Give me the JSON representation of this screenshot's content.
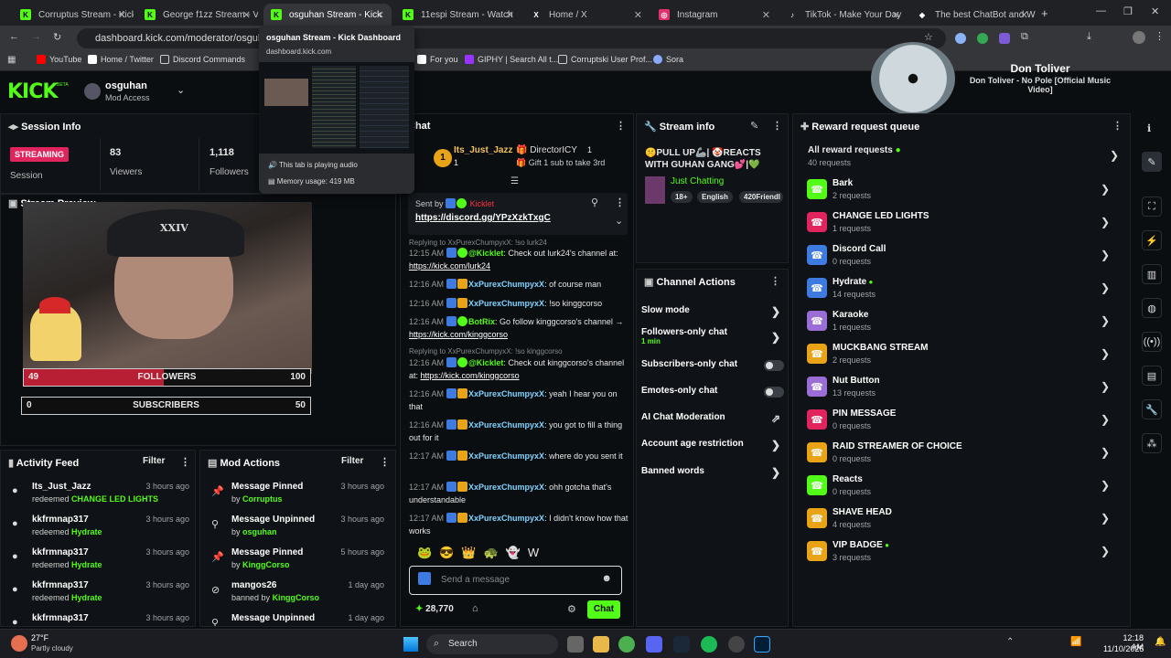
{
  "tabs": [
    {
      "title": "Corruptus Stream - Kick D",
      "fav": "K",
      "color": "#53fc18"
    },
    {
      "title": "George f1zz Stream - V",
      "fav": "K",
      "color": "#53fc18"
    },
    {
      "title": "osguhan Stream - Kick",
      "fav": "K",
      "color": "#53fc18"
    },
    {
      "title": "11espi Stream - Watch",
      "fav": "K",
      "color": "#53fc18"
    },
    {
      "title": "Home / X",
      "fav": "X",
      "color": "#ffffff"
    },
    {
      "title": "Instagram",
      "fav": "◎",
      "color": "#e1306c"
    },
    {
      "title": "TikTok - Make Your Day",
      "fav": "♪",
      "color": "#ffffff"
    },
    {
      "title": "The best ChatBot and Wi",
      "fav": "◆",
      "color": "#ffffff"
    }
  ],
  "tooltip": {
    "title": "osguhan Stream - Kick Dashboard",
    "domain": "dashboard.kick.com",
    "audio": "This tab is playing audio",
    "memory": "Memory usage: 419 MB"
  },
  "address": {
    "url": "dashboard.kick.com/moderator/osguhan"
  },
  "bookmarks": [
    "YouTube",
    "Home / Twitter",
    "Discord Commands",
    "For you",
    "GIPHY | Search All t...",
    "Corruptski User Prof...",
    "Sora"
  ],
  "header": {
    "logo": "KICK",
    "beta": "BETA",
    "user": "osguhan",
    "role": "Mod Access"
  },
  "now_playing": {
    "artist": "Don Toliver",
    "track": "Don Toliver - No Pole [Official Music Video]"
  },
  "session": {
    "title": "Session Info",
    "status": "STREAMING",
    "session_label": "Session",
    "viewers": "83",
    "viewers_label": "Viewers",
    "followers": "1,118",
    "followers_label": "Followers"
  },
  "preview": {
    "title": "Stream Preview",
    "followers_goal": {
      "current": "49",
      "label": "FOLLOWERS",
      "target": "100",
      "fraction": 0.49
    },
    "subs_goal": {
      "current": "0",
      "label": "SUBSCRIBERS",
      "target": "50",
      "fraction": 0
    }
  },
  "activity": {
    "title": "Activity Feed",
    "filter": "Filter",
    "items": [
      {
        "name": "Its_Just_Jazz",
        "prefix": "redeemed",
        "reward": "CHANGE LED LIGHTS",
        "time": "3 hours ago"
      },
      {
        "name": "kkfrmnap317",
        "prefix": "redeemed",
        "reward": "Hydrate",
        "time": "3 hours ago"
      },
      {
        "name": "kkfrmnap317",
        "prefix": "redeemed",
        "reward": "Hydrate",
        "time": "3 hours ago"
      },
      {
        "name": "kkfrmnap317",
        "prefix": "redeemed",
        "reward": "Hydrate",
        "time": "3 hours ago"
      },
      {
        "name": "kkfrmnap317",
        "prefix": "",
        "reward": "",
        "time": "3 hours ago"
      }
    ]
  },
  "modactions": {
    "title": "Mod Actions",
    "filter": "Filter",
    "items": [
      {
        "action": "Message Pinned",
        "by": "by",
        "user": "Corruptus",
        "time": "3 hours ago",
        "icon": "pin"
      },
      {
        "action": "Message Unpinned",
        "by": "by",
        "user": "osguhan",
        "time": "3 hours ago",
        "icon": "unpin"
      },
      {
        "action": "Message Pinned",
        "by": "by",
        "user": "KinggCorso",
        "time": "5 hours ago",
        "icon": "pin"
      },
      {
        "action": "mangos26",
        "by": "banned by",
        "user": "KinggCorso",
        "time": "1 day ago",
        "icon": "ban"
      },
      {
        "action": "Message Unpinned",
        "by": "",
        "user": "",
        "time": "1 day ago",
        "icon": "unpin"
      }
    ]
  },
  "chat": {
    "title": "Chat",
    "top_gifter": {
      "rank": "1",
      "name": "Its_Just_Jazz",
      "count": "1",
      "other": "DirectorICY",
      "other_count": "1",
      "gift_note": "Gift 1 sub to take 3rd"
    },
    "pinned": {
      "sent_by": "Sent by",
      "sender": "Kicklet",
      "link": "https://discord.gg/YPzXzkTxgC"
    },
    "messages": [
      {
        "reply": "Replying to XxPurexChumpyxX: !so lurk24"
      },
      {
        "time": "12:15 AM",
        "user": "@Kicklet",
        "text": "Check out lurk24's channel at:",
        "link": "https://kick.com/lurk24",
        "bot": true
      },
      {
        "time": "12:16 AM",
        "user": "XxPurexChumpyxX",
        "text": "of course man"
      },
      {
        "time": "12:16 AM",
        "user": "XxPurexChumpyxX",
        "text": "!so kinggcorso"
      },
      {
        "time": "12:16 AM",
        "user": "BotRix",
        "text": "Go follow kinggcorso's channel →",
        "link": "https://kick.com/kinggcorso",
        "bot": true
      },
      {
        "reply": "Replying to XxPurexChumpyxX: !so kinggcorso"
      },
      {
        "time": "12:16 AM",
        "user": "@Kicklet",
        "text": "Check out kinggcorso's channel at:",
        "link": "https://kick.com/kinggcorso",
        "bot": true
      },
      {
        "time": "12:16 AM",
        "user": "XxPurexChumpyxX",
        "text": "yeah I hear you on that"
      },
      {
        "time": "12:16 AM",
        "user": "XxPurexChumpyxX",
        "text": "you got to fill a thing out for it"
      },
      {
        "time": "12:17 AM",
        "user": "XxPurexChumpyxX",
        "text": "where do you sent it"
      },
      {
        "time": "12:17 AM",
        "user": "XxPurexChumpyxX",
        "text": "ohh gotcha that's understandable"
      },
      {
        "time": "12:17 AM",
        "user": "XxPurexChumpyxX",
        "text": "I didn't know how that works"
      }
    ],
    "input_placeholder": "Send a message",
    "points": "28,770",
    "send": "Chat"
  },
  "stream_info": {
    "title": "Stream info",
    "stream_title": "🤫PULL UP🦾| 🤡REACTS WITH GUHAN GANG💕|💚GRINDING...",
    "category": "Just Chatting",
    "tags": [
      "18+",
      "English",
      "420Friendl"
    ]
  },
  "channel_actions": {
    "title": "Channel Actions",
    "items": [
      {
        "label": "Slow mode",
        "sub": "",
        "kind": "chevron"
      },
      {
        "label": "Followers-only chat",
        "sub": "1 min",
        "kind": "chevron"
      },
      {
        "label": "Subscribers-only chat",
        "sub": "",
        "kind": "toggle"
      },
      {
        "label": "Emotes-only chat",
        "sub": "",
        "kind": "toggle"
      },
      {
        "label": "AI Chat Moderation",
        "sub": "",
        "kind": "external"
      },
      {
        "label": "Account age restriction",
        "sub": "",
        "kind": "chevron"
      },
      {
        "label": "Banned words",
        "sub": "",
        "kind": "chevron"
      }
    ]
  },
  "rewards": {
    "title": "Reward request queue",
    "all": {
      "label": "All reward requests",
      "count": "40 requests"
    },
    "items": [
      {
        "name": "Bark",
        "count": "2 requests",
        "color": "#53fc18",
        "dot": false
      },
      {
        "name": "CHANGE LED LIGHTS",
        "count": "1 requests",
        "color": "#e0245e",
        "dot": false
      },
      {
        "name": "Discord Call",
        "count": "0 requests",
        "color": "#3d7be0",
        "dot": false
      },
      {
        "name": "Hydrate",
        "count": "14 requests",
        "color": "#3d7be0",
        "dot": true
      },
      {
        "name": "Karaoke",
        "count": "1 requests",
        "color": "#9b6dd6",
        "dot": false
      },
      {
        "name": "MUCKBANG STREAM",
        "count": "2 requests",
        "color": "#e8a317",
        "dot": false
      },
      {
        "name": "Nut Button",
        "count": "13 requests",
        "color": "#9b6dd6",
        "dot": false
      },
      {
        "name": "PIN MESSAGE",
        "count": "0 requests",
        "color": "#e0245e",
        "dot": false
      },
      {
        "name": "RAID STREAMER OF CHOICE",
        "count": "0 requests",
        "color": "#e8a317",
        "dot": false
      },
      {
        "name": "Reacts",
        "count": "0 requests",
        "color": "#53fc18",
        "dot": false
      },
      {
        "name": "SHAVE HEAD",
        "count": "4 requests",
        "color": "#e8a317",
        "dot": false
      },
      {
        "name": "VIP BADGE",
        "count": "3 requests",
        "color": "#e8a317",
        "dot": true
      }
    ]
  },
  "taskbar": {
    "weather": "27°F",
    "weather_desc": "Partly cloudy",
    "search": "Search",
    "time": "12:18 AM",
    "date": "11/10/2025"
  }
}
